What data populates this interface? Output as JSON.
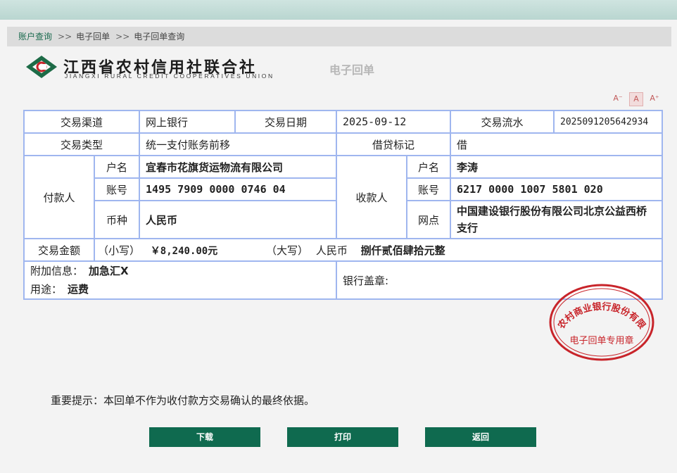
{
  "breadcrumb": {
    "items": [
      "账户查询",
      "电子回单",
      "电子回单查询"
    ],
    "separator": ">>"
  },
  "header": {
    "bank_name_cn": "江西省农村信用社联合社",
    "bank_name_en": "JIANGXI RURAL CREDIT COOPERATIVES UNION",
    "doc_title": "电子回单"
  },
  "font_controls": {
    "decrease": "A⁻",
    "normal": "A",
    "increase": "A⁺"
  },
  "voucher": {
    "channel_label": "交易渠道",
    "channel_value": "网上银行",
    "date_label": "交易日期",
    "date_value": "2025-09-12",
    "serial_label": "交易流水",
    "serial_value": "2025091205642934",
    "type_label": "交易类型",
    "type_value": "统一支付账务前移",
    "dc_label": "借贷标记",
    "dc_value": "借",
    "payer_label": "付款人",
    "payer_name_label": "户名",
    "payer_name": "宜春市花旗货运物流有限公司",
    "payer_acct_label": "账号",
    "payer_acct": "1495 7909 0000 0746 04",
    "currency_label": "币种",
    "currency": "人民币",
    "payee_label": "收款人",
    "payee_name_label": "户名",
    "payee_name": "李涛",
    "payee_acct_label": "账号",
    "payee_acct": "6217 0000 1007 5801 020",
    "payee_branch_label": "网点",
    "payee_branch": "中国建设银行股份有限公司北京公益西桥支行",
    "amount_label": "交易金额",
    "amount_small_label": "（小写）",
    "amount_small": "￥8,240.00元",
    "amount_big_label": "（大写）",
    "amount_big_currency": "人民币",
    "amount_big": "捌仟贰佰肆拾元整",
    "extra_label": "附加信息：",
    "extra_value": "加急汇X",
    "purpose_label": "用途：",
    "purpose_value": "运费",
    "seal_label": "银行盖章:"
  },
  "stamp": {
    "ring_text": "宜春农村商业银行股份有限公司",
    "center_text": "电子回单专用章",
    "color": "#c8242a"
  },
  "notice": "重要提示：本回单不作为收付款方交易确认的最终依据。",
  "buttons": {
    "download": "下载",
    "print": "打印",
    "back": "返回"
  },
  "colors": {
    "brand": "#0f6a4f",
    "table_border": "#9fb6ef"
  }
}
